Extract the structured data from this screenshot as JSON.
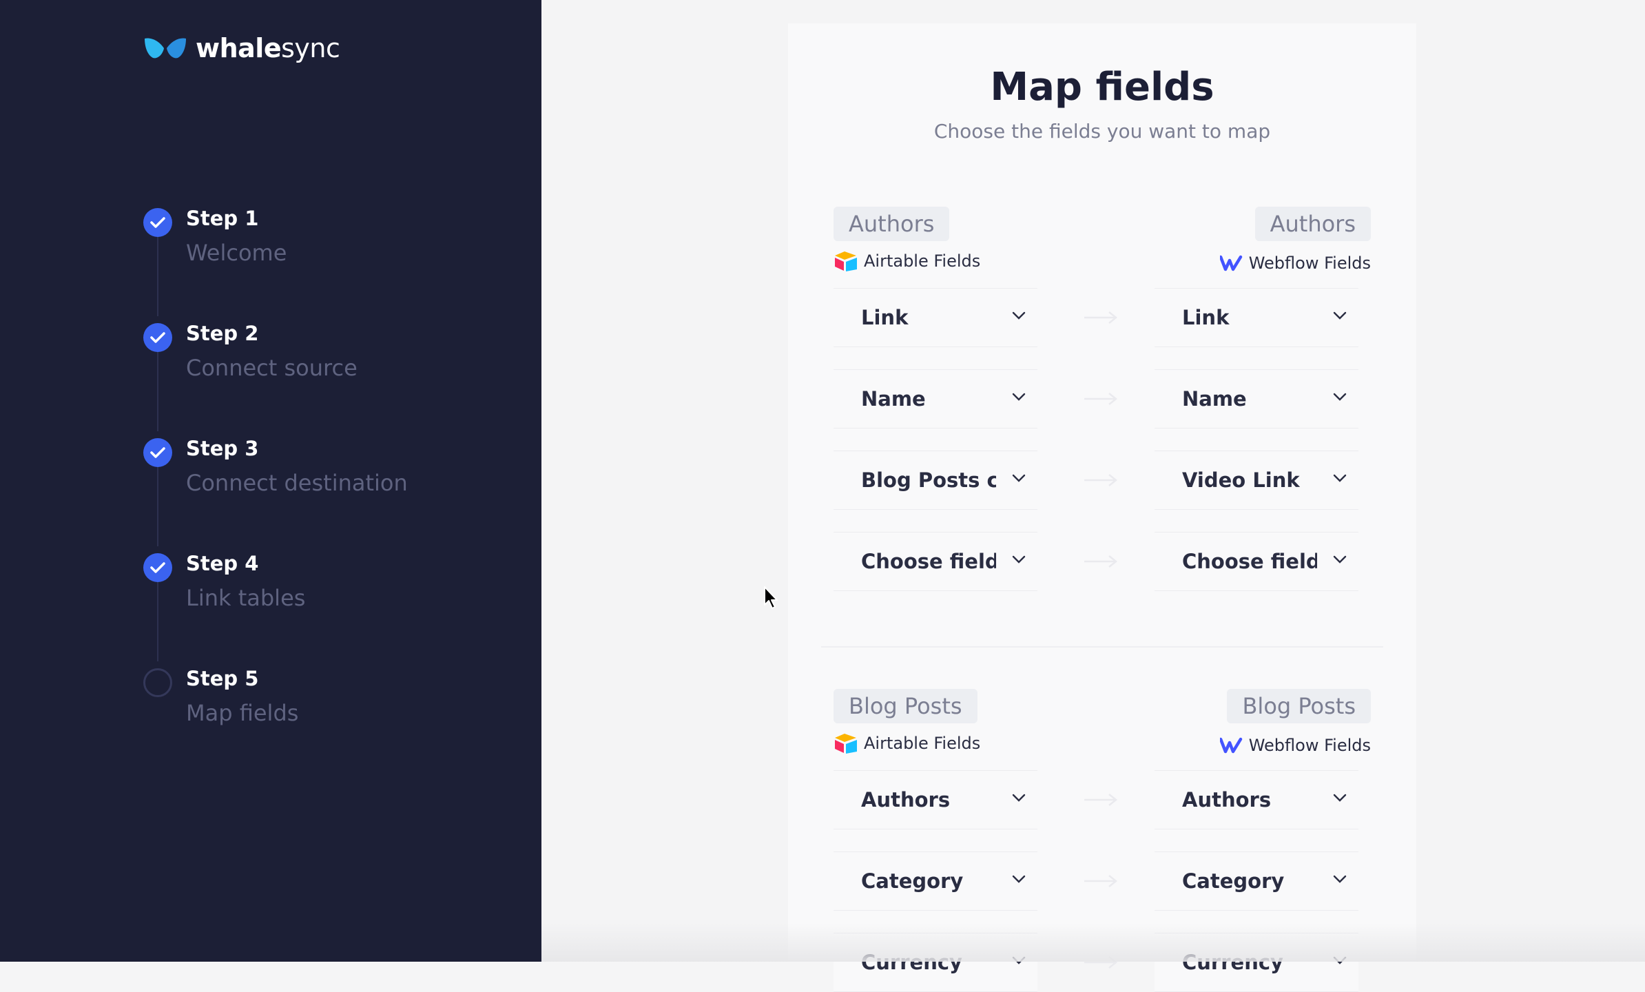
{
  "brand": {
    "name_bold": "whale",
    "name_light": "sync"
  },
  "colors": {
    "sidebar_bg": "#1c1f36",
    "accent": "#3b63f0",
    "airtable_red": "#f04b46",
    "webflow_blue": "#4353ff"
  },
  "steps": [
    {
      "title": "Step 1",
      "subtitle": "Welcome",
      "status": "complete"
    },
    {
      "title": "Step 2",
      "subtitle": "Connect source",
      "status": "complete"
    },
    {
      "title": "Step 3",
      "subtitle": "Connect destination",
      "status": "complete"
    },
    {
      "title": "Step 4",
      "subtitle": "Link tables",
      "status": "complete"
    },
    {
      "title": "Step 5",
      "subtitle": "Map fields",
      "status": "current"
    }
  ],
  "page": {
    "title": "Map fields",
    "subtitle": "Choose the fields you want to map"
  },
  "sections": [
    {
      "left_table": "Authors",
      "right_table": "Authors",
      "left_source": "Airtable Fields",
      "right_source": "Webflow Fields",
      "rows": [
        {
          "left": "Link",
          "right": "Link"
        },
        {
          "left": "Name",
          "right": "Name"
        },
        {
          "left": "Blog Posts cop",
          "right": "Video Link"
        },
        {
          "left": "Choose field",
          "right": "Choose field"
        }
      ]
    },
    {
      "left_table": "Blog Posts",
      "right_table": "Blog Posts",
      "left_source": "Airtable Fields",
      "right_source": "Webflow Fields",
      "rows": [
        {
          "left": "Authors",
          "right": "Authors"
        },
        {
          "left": "Category",
          "right": "Category"
        },
        {
          "left": "Currency",
          "right": "Currency"
        }
      ]
    }
  ]
}
